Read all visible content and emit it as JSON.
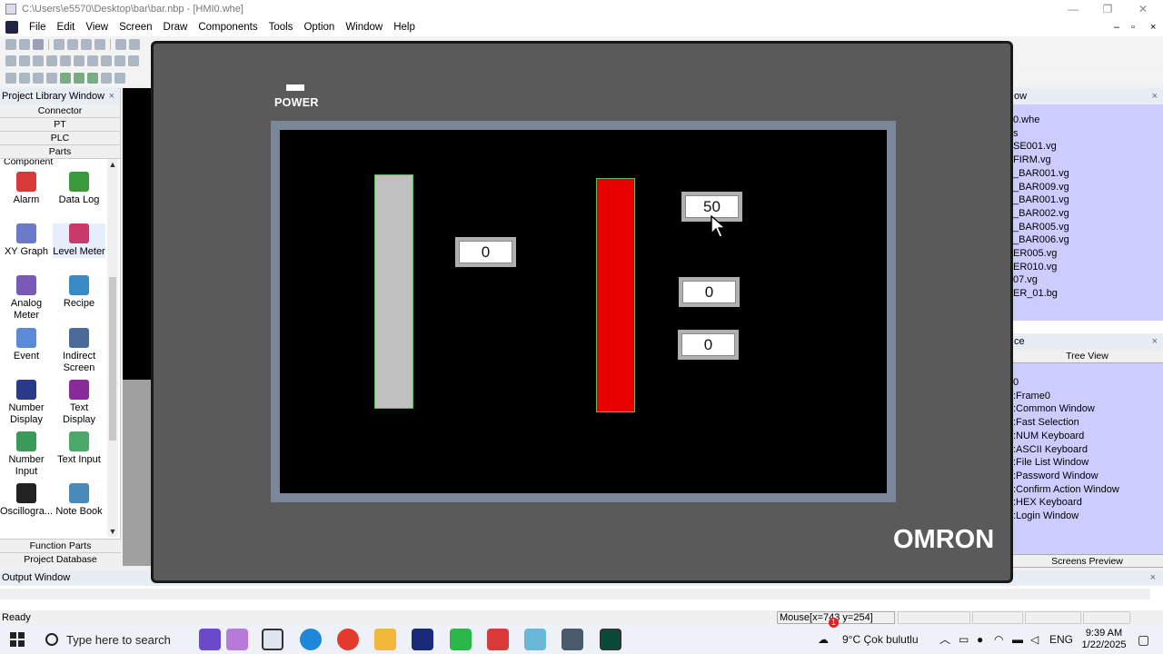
{
  "window": {
    "title": "C:\\Users\\e5570\\Desktop\\bar\\bar.nbp - [HMI0.whe]",
    "min": "—",
    "max": "❐",
    "close": "✕"
  },
  "menu": [
    "File",
    "Edit",
    "View",
    "Screen",
    "Draw",
    "Components",
    "Tools",
    "Option",
    "Window",
    "Help"
  ],
  "left_panel": {
    "title": "Project Library Window",
    "close": "×",
    "tabs": [
      "Connector",
      "PT",
      "PLC",
      "Parts"
    ],
    "category": "Component",
    "items": [
      {
        "label": "Alarm",
        "icon": "alarm-icon",
        "color": "#d83a3a"
      },
      {
        "label": "Data Log",
        "icon": "data-log-icon",
        "color": "#3a9a3a"
      },
      {
        "label": "XY Graph",
        "icon": "xy-graph-icon",
        "color": "#6a7ac8"
      },
      {
        "label": "Level Meter",
        "icon": "level-meter-icon",
        "color": "#c83a6a"
      },
      {
        "label": "Analog Meter",
        "icon": "analog-meter-icon",
        "color": "#7a5ab8"
      },
      {
        "label": "Recipe",
        "icon": "recipe-icon",
        "color": "#3a8ac8"
      },
      {
        "label": "Event",
        "icon": "event-icon",
        "color": "#5a8ad8"
      },
      {
        "label": "Indirect Screen",
        "icon": "indirect-screen-icon",
        "color": "#4a6a9a"
      },
      {
        "label": "Number Display",
        "icon": "number-display-icon",
        "color": "#2a3a8a"
      },
      {
        "label": "Text Display",
        "icon": "text-display-icon",
        "color": "#8a2a9a"
      },
      {
        "label": "Number Input",
        "icon": "number-input-icon",
        "color": "#3a9a5a"
      },
      {
        "label": "Text Input",
        "icon": "text-input-icon",
        "color": "#4aa86a"
      },
      {
        "label": "Oscillogra...",
        "icon": "oscillograph-icon",
        "color": "#222222"
      },
      {
        "label": "Note Book",
        "icon": "note-book-icon",
        "color": "#4a8ab8"
      }
    ],
    "bottom_tabs": [
      "Function Parts",
      "Project Database"
    ]
  },
  "right_panel": {
    "top_title": "ow",
    "files": [
      "0.whe",
      "s",
      "SE001.vg",
      "FIRM.vg",
      "_BAR001.vg",
      "_BAR009.vg",
      "_BAR001.vg",
      "_BAR002.vg",
      "_BAR005.vg",
      "_BAR006.vg",
      "ER005.vg",
      "ER010.vg",
      "07.vg",
      "ER_01.bg"
    ],
    "tree_title": "ce",
    "tree_tab": "Tree View",
    "tree": [
      "0",
      ":Frame0",
      ":Common Window",
      ":Fast Selection",
      ":NUM Keyboard",
      ":ASCII Keyboard",
      ":File List Window",
      ":Password Window",
      ":Confirm Action Window",
      ":HEX Keyboard",
      ":Login Window"
    ],
    "bottom_tab": "Screens Preview"
  },
  "hmi": {
    "power_label": "POWER",
    "brand": "OMRON",
    "gray_bar_color": "#c0c0c0",
    "red_bar_color": "#e60000",
    "displays": {
      "left": "0",
      "top_right": "50",
      "mid_right": "0",
      "bottom_right": "0"
    }
  },
  "output": {
    "title": "Output Window",
    "close": "×"
  },
  "status": {
    "ready": "Ready",
    "mouse": "Mouse[x=743  y=254]"
  },
  "taskbar": {
    "search_placeholder": "Type here to search",
    "weather": "9°C  Çok bulutlu",
    "weather_badge": "1",
    "lang": "ENG",
    "time": "9:39 AM",
    "date": "1/22/2025"
  }
}
